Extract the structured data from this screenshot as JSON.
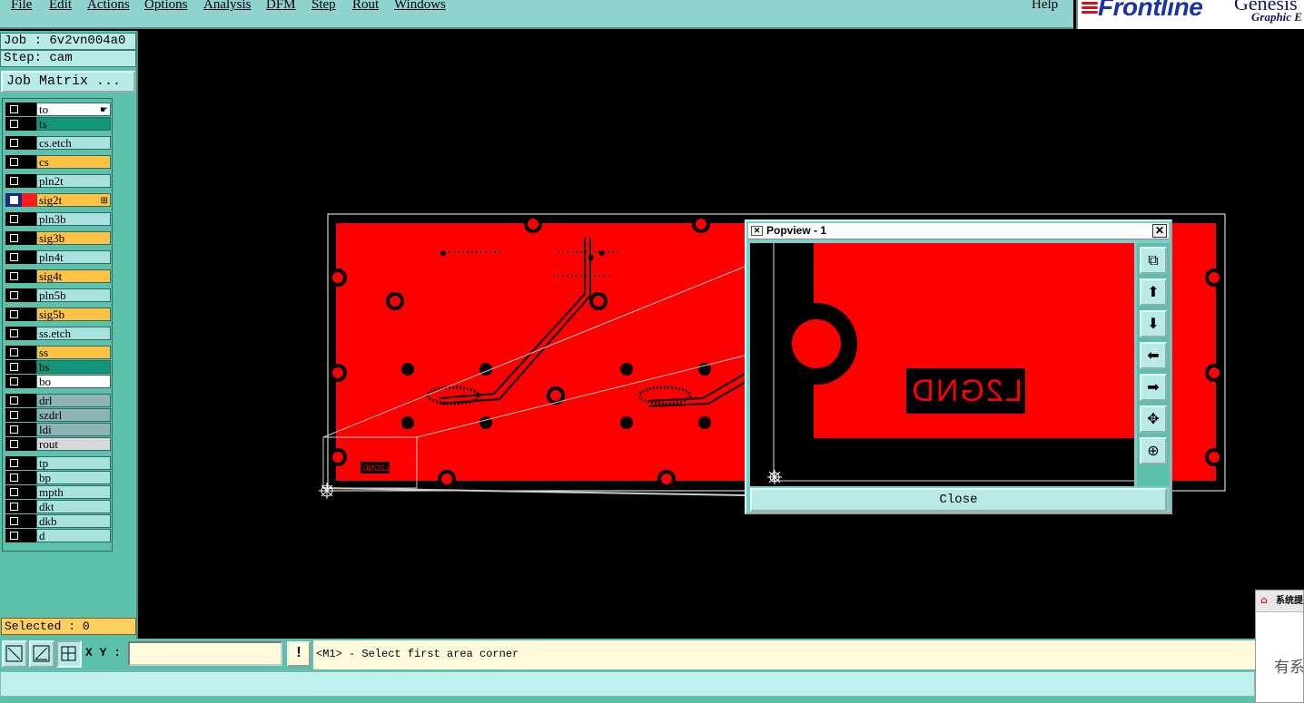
{
  "menubar": {
    "items": [
      "File",
      "Edit",
      "Actions",
      "Options",
      "Analysis",
      "DFM",
      "Step",
      "Rout",
      "Windows"
    ],
    "help": "Help"
  },
  "logo": {
    "brand": "Frontline",
    "product": "Genesis",
    "subtitle": "Graphic E"
  },
  "left_panel": {
    "job": "Job : 6v2vn004a0",
    "step": "Step: cam",
    "job_matrix_label": "Job Matrix ...",
    "selected": "Selected : 0",
    "layers": [
      {
        "name": "to",
        "color": "#ffffff",
        "mark": "pointer"
      },
      {
        "name": "ts",
        "color": "#12967a"
      },
      {
        "name": "cs.etch",
        "color": "#a8e2de"
      },
      {
        "name": "cs",
        "color": "#ffc244"
      },
      {
        "name": "pln2t",
        "color": "#a8e2de"
      },
      {
        "name": "sig2t",
        "color": "#ffc244",
        "active": true,
        "mark": "grid"
      },
      {
        "name": "pln3b",
        "color": "#a8e2de"
      },
      {
        "name": "sig3b",
        "color": "#ffc244"
      },
      {
        "name": "pln4t",
        "color": "#a8e2de"
      },
      {
        "name": "sig4t",
        "color": "#ffc244"
      },
      {
        "name": "pln5b",
        "color": "#a8e2de"
      },
      {
        "name": "sig5b",
        "color": "#ffc244"
      },
      {
        "name": "ss.etch",
        "color": "#a8e2de"
      },
      {
        "name": "ss",
        "color": "#ffc244"
      },
      {
        "name": "bs",
        "color": "#12967a"
      },
      {
        "name": "bo",
        "color": "#ffffff"
      },
      {
        "name": "drl",
        "color": "#8fb4b8"
      },
      {
        "name": "szdrl",
        "color": "#8fb4b8"
      },
      {
        "name": "ldi",
        "color": "#8fb4b8"
      },
      {
        "name": "rout",
        "color": "#d8d8d8"
      },
      {
        "name": "tp",
        "color": "#a8e2de"
      },
      {
        "name": "bp",
        "color": "#a8e2de"
      },
      {
        "name": "mpth",
        "color": "#a8e2de"
      },
      {
        "name": "dkt",
        "color": "#a8e2de"
      },
      {
        "name": "dkb",
        "color": "#a8e2de"
      },
      {
        "name": "d",
        "color": "#a8e2de"
      }
    ]
  },
  "canvas": {
    "board_color": "#ff0000",
    "small_label": "L2GND"
  },
  "popview": {
    "title": "Popview - 1",
    "close_label": "Close",
    "zoom_text": "L2GND",
    "tools": [
      "zoom-window-icon",
      "pan-up-icon",
      "pan-down-icon",
      "pan-left-icon",
      "pan-right-icon",
      "zoom-in-icon",
      "zoom-out-icon"
    ]
  },
  "bottom": {
    "xy_label": "X Y :",
    "xy_value": "",
    "exclaim": "!",
    "prompt": "<M1> - Select first area corner"
  },
  "notify": {
    "header": "系统提",
    "text": "有系"
  }
}
